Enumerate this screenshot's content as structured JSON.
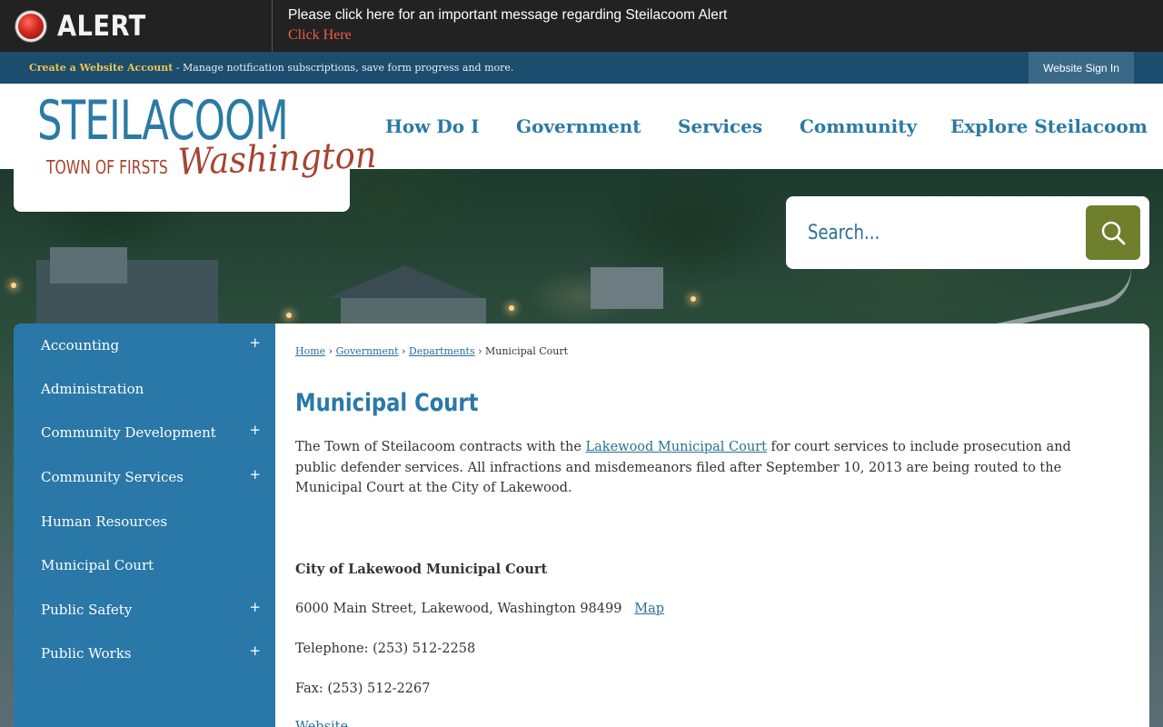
{
  "alert": {
    "label": "ALERT",
    "message": "Please click here for an important message regarding Steilacoom Alert",
    "link_text": "Click Here"
  },
  "account_bar": {
    "create_link": "Create a Website Account",
    "description": " - Manage notification subscriptions, save form progress and more.",
    "sign_in": "Website Sign In"
  },
  "logo": {
    "main": "STEILACOOM",
    "sub": "TOWN OF FIRSTS",
    "script": "Washington"
  },
  "nav": {
    "items": [
      "How Do I",
      "Government",
      "Services",
      "Community",
      "Explore Steilacoom"
    ]
  },
  "search": {
    "placeholder": "Search..."
  },
  "sidebar": {
    "items": [
      {
        "label": "Accounting",
        "expand": "+"
      },
      {
        "label": "Administration",
        "expand": ""
      },
      {
        "label": "Community Development",
        "expand": "+"
      },
      {
        "label": "Community Services",
        "expand": "+"
      },
      {
        "label": "Human Resources",
        "expand": ""
      },
      {
        "label": "Municipal Court",
        "expand": ""
      },
      {
        "label": "Public Safety",
        "expand": "+"
      },
      {
        "label": "Public Works",
        "expand": "+"
      }
    ]
  },
  "breadcrumb": {
    "home": "Home",
    "government": "Government",
    "departments": "Departments",
    "current": "Municipal Court",
    "separator": "›"
  },
  "content": {
    "title": "Municipal Court",
    "intro_before": "The Town of Steilacoom contracts with the ",
    "intro_link": "Lakewood Municipal Court",
    "intro_after": " for court services to include prosecution and public defender services. All infractions and misdemeanors filed after September 10, 2013 are being routed to the Municipal Court at the City of Lakewood.",
    "court_name": "City of Lakewood Municipal Court",
    "address": "6000 Main Street, Lakewood, Washington 98499",
    "map_link": "Map",
    "telephone": "Telephone: (253) 512-2258",
    "fax": "Fax: (253) 512-2267",
    "website_link": "Website"
  }
}
